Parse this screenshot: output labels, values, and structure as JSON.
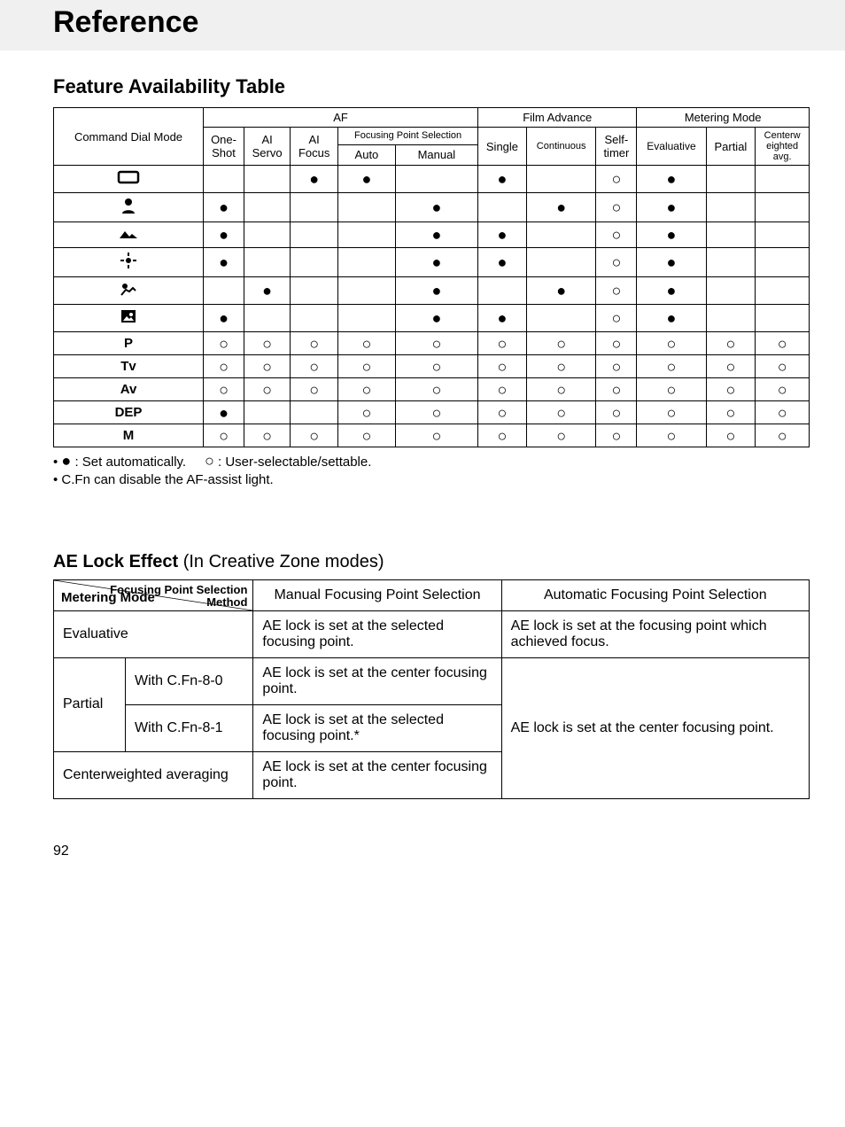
{
  "page_title": "Reference",
  "section1_title": "Feature Availability Table",
  "page_number": "92",
  "table1": {
    "header": {
      "row_label": "Command Dial Mode",
      "groups": [
        {
          "label": "AF",
          "cols": [
            {
              "id": "one_shot",
              "label": "One-\nShot"
            },
            {
              "id": "ai_servo",
              "label": "AI\nServo"
            },
            {
              "id": "ai_focus",
              "label": "AI\nFocus"
            },
            {
              "id": "fp_auto",
              "group": "Focusing Point Selection",
              "label": "Auto"
            },
            {
              "id": "fp_manual",
              "group": "Focusing Point Selection",
              "label": "Manual"
            }
          ]
        },
        {
          "label": "Film Advance",
          "cols": [
            {
              "id": "single",
              "label": "Single"
            },
            {
              "id": "continuous",
              "label": "Continuous"
            },
            {
              "id": "self_timer",
              "label": "Self-\ntimer"
            }
          ]
        },
        {
          "label": "Metering Mode",
          "cols": [
            {
              "id": "evaluative",
              "label": "Evaluative"
            },
            {
              "id": "partial",
              "label": "Partial"
            },
            {
              "id": "cw_avg",
              "label": "Centerw\neighted\navg."
            }
          ]
        }
      ]
    },
    "rows": [
      {
        "id": "full_auto",
        "label_icon": "rect-icon",
        "label": "",
        "cells": {
          "one_shot": "",
          "ai_servo": "",
          "ai_focus": "F",
          "fp_auto": "F",
          "fp_manual": "",
          "single": "F",
          "continuous": "",
          "self_timer": "O",
          "evaluative": "F",
          "partial": "",
          "cw_avg": ""
        }
      },
      {
        "id": "portrait",
        "label_icon": "portrait-icon",
        "label": "",
        "cells": {
          "one_shot": "F",
          "ai_servo": "",
          "ai_focus": "",
          "fp_auto": "",
          "fp_manual": "F",
          "single": "",
          "continuous": "F",
          "self_timer": "O",
          "evaluative": "F",
          "partial": "",
          "cw_avg": ""
        }
      },
      {
        "id": "landscape",
        "label_icon": "landscape-icon",
        "label": "",
        "cells": {
          "one_shot": "F",
          "ai_servo": "",
          "ai_focus": "",
          "fp_auto": "",
          "fp_manual": "F",
          "single": "F",
          "continuous": "",
          "self_timer": "O",
          "evaluative": "F",
          "partial": "",
          "cw_avg": ""
        }
      },
      {
        "id": "closeup",
        "label_icon": "closeup-icon",
        "label": "",
        "cells": {
          "one_shot": "F",
          "ai_servo": "",
          "ai_focus": "",
          "fp_auto": "",
          "fp_manual": "F",
          "single": "F",
          "continuous": "",
          "self_timer": "O",
          "evaluative": "F",
          "partial": "",
          "cw_avg": ""
        }
      },
      {
        "id": "sports",
        "label_icon": "sports-icon",
        "label": "",
        "cells": {
          "one_shot": "",
          "ai_servo": "F",
          "ai_focus": "",
          "fp_auto": "",
          "fp_manual": "F",
          "single": "",
          "continuous": "F",
          "self_timer": "O",
          "evaluative": "F",
          "partial": "",
          "cw_avg": ""
        }
      },
      {
        "id": "night",
        "label_icon": "night-icon",
        "label": "",
        "cells": {
          "one_shot": "F",
          "ai_servo": "",
          "ai_focus": "",
          "fp_auto": "",
          "fp_manual": "F",
          "single": "F",
          "continuous": "",
          "self_timer": "O",
          "evaluative": "F",
          "partial": "",
          "cw_avg": ""
        }
      },
      {
        "id": "P",
        "label": "P",
        "cells": {
          "one_shot": "O",
          "ai_servo": "O",
          "ai_focus": "O",
          "fp_auto": "O",
          "fp_manual": "O",
          "single": "O",
          "continuous": "O",
          "self_timer": "O",
          "evaluative": "O",
          "partial": "O",
          "cw_avg": "O"
        }
      },
      {
        "id": "Tv",
        "label": "Tv",
        "cells": {
          "one_shot": "O",
          "ai_servo": "O",
          "ai_focus": "O",
          "fp_auto": "O",
          "fp_manual": "O",
          "single": "O",
          "continuous": "O",
          "self_timer": "O",
          "evaluative": "O",
          "partial": "O",
          "cw_avg": "O"
        }
      },
      {
        "id": "Av",
        "label": "Av",
        "cells": {
          "one_shot": "O",
          "ai_servo": "O",
          "ai_focus": "O",
          "fp_auto": "O",
          "fp_manual": "O",
          "single": "O",
          "continuous": "O",
          "self_timer": "O",
          "evaluative": "O",
          "partial": "O",
          "cw_avg": "O"
        }
      },
      {
        "id": "DEP",
        "label": "DEP",
        "cells": {
          "one_shot": "F",
          "ai_servo": "",
          "ai_focus": "",
          "fp_auto": "O",
          "fp_manual": "O",
          "single": "O",
          "continuous": "O",
          "self_timer": "O",
          "evaluative": "O",
          "partial": "O",
          "cw_avg": "O"
        }
      },
      {
        "id": "M",
        "label": "M",
        "cells": {
          "one_shot": "O",
          "ai_servo": "O",
          "ai_focus": "O",
          "fp_auto": "O",
          "fp_manual": "O",
          "single": "O",
          "continuous": "O",
          "self_timer": "O",
          "evaluative": "O",
          "partial": "O",
          "cw_avg": "O"
        }
      }
    ],
    "legend": {
      "filled": ": Set automatically.",
      "open": ": User-selectable/settable.",
      "note2": "C.Fn can disable the AF-assist light."
    }
  },
  "section2": {
    "title": "AE Lock Effect",
    "subtitle": "(In Creative Zone modes)",
    "diag_top": "Focusing Point Selection\nMethod",
    "diag_bottom": "Metering Mode",
    "col_manual": "Manual Focusing Point Selection",
    "col_auto": "Automatic Focusing Point Selection",
    "rows": {
      "evaluative": {
        "label": "Evaluative",
        "manual": "AE lock is set at the selected focusing point.",
        "auto": "AE lock is set at the focusing point which achieved focus."
      },
      "partial": {
        "label": "Partial",
        "sub1_label": "With C.Fn-8-0",
        "sub1_manual": "AE lock is set at the center focusing point.",
        "sub2_label": "With C.Fn-8-1",
        "sub2_manual": "AE lock is set at the selected focusing point.*",
        "auto": "AE lock is set at the center focusing point."
      },
      "cw": {
        "label": "Centerweighted averaging",
        "manual": "AE lock is set at the center focusing point."
      }
    }
  }
}
